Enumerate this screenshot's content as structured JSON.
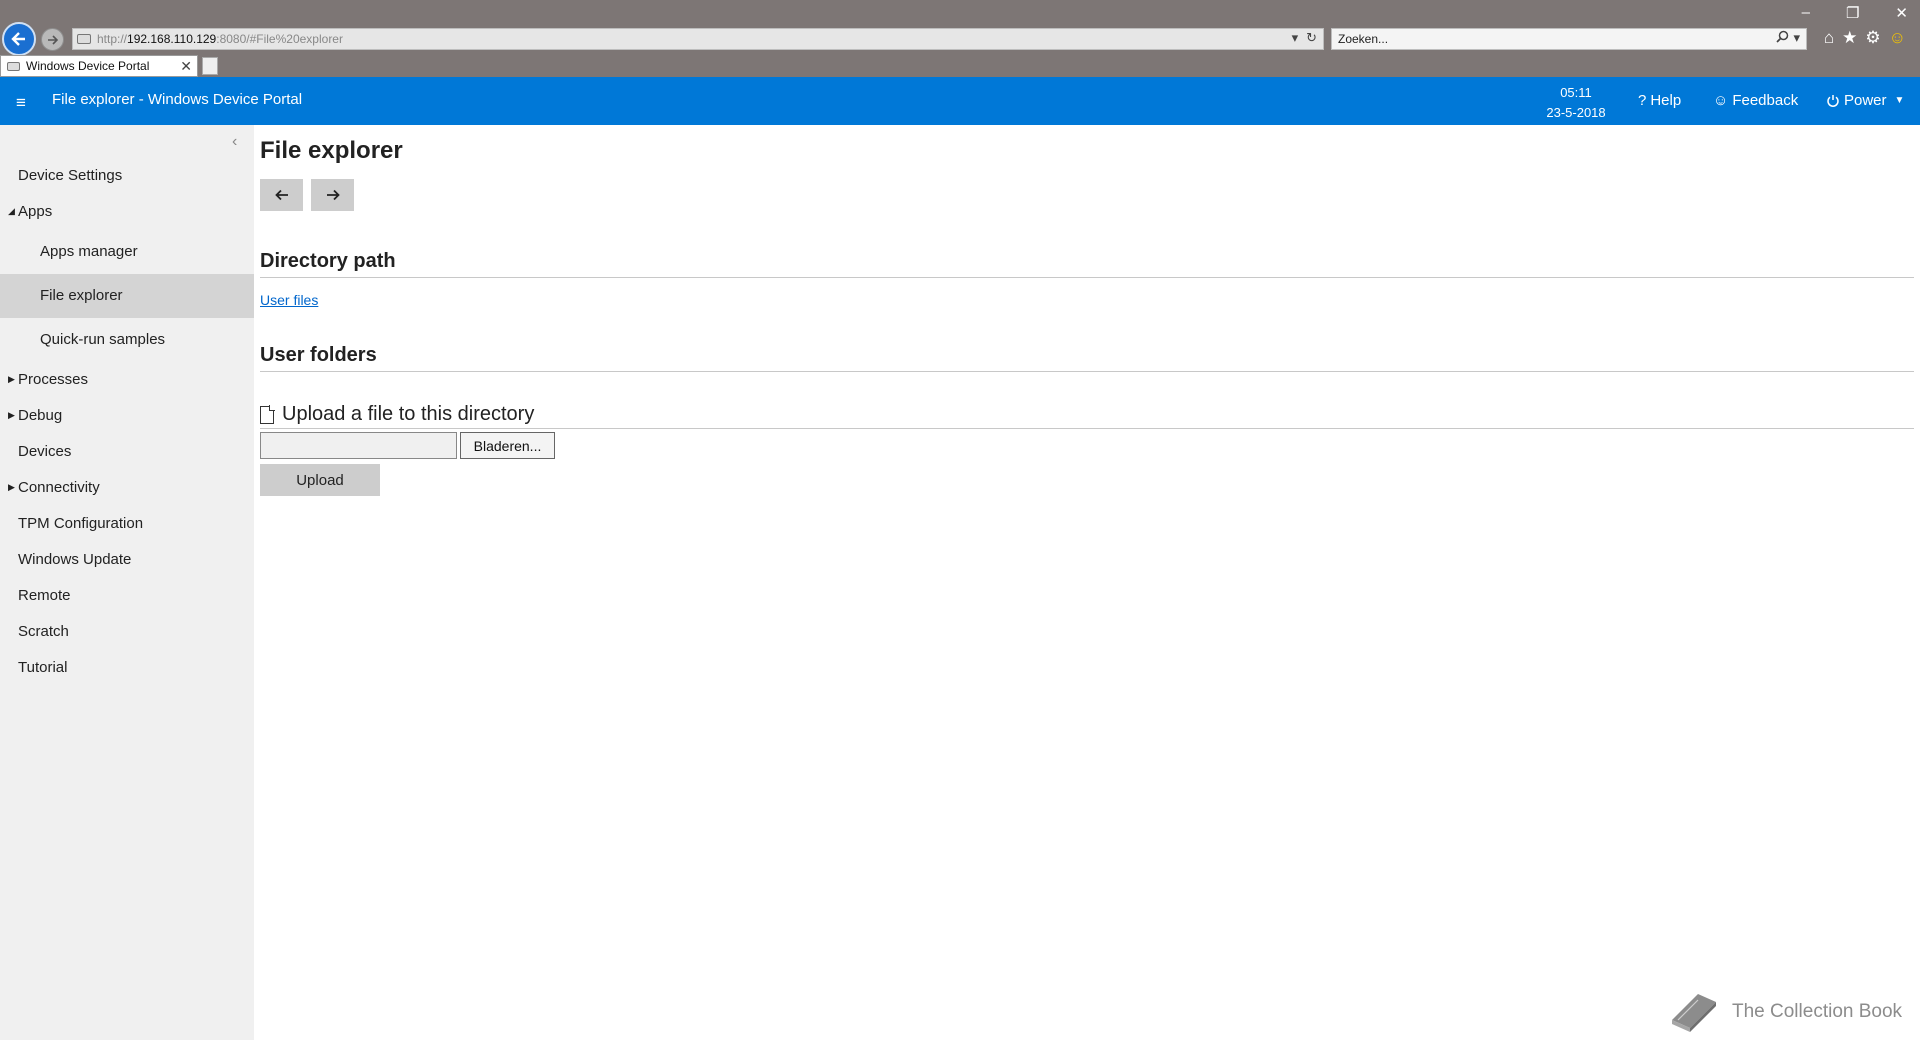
{
  "browser": {
    "url_scheme": "http://",
    "url_host": "192.168.110.129",
    "url_rest": ":8080/#File%20explorer",
    "search_placeholder": "Zoeken...",
    "tab_title": "Windows Device Portal"
  },
  "header": {
    "title": "File explorer - Windows Device Portal",
    "time": "05:11",
    "date": "23-5-2018",
    "help_label": "Help",
    "feedback_label": "Feedback",
    "power_label": "Power"
  },
  "sidebar": {
    "items": [
      {
        "label": "Device Settings"
      },
      {
        "label": "Apps"
      },
      {
        "label": "Apps manager"
      },
      {
        "label": "File explorer"
      },
      {
        "label": "Quick-run samples"
      },
      {
        "label": "Processes"
      },
      {
        "label": "Debug"
      },
      {
        "label": "Devices"
      },
      {
        "label": "Connectivity"
      },
      {
        "label": "TPM Configuration"
      },
      {
        "label": "Windows Update"
      },
      {
        "label": "Remote"
      },
      {
        "label": "Scratch"
      },
      {
        "label": "Tutorial"
      }
    ]
  },
  "main": {
    "title": "File explorer",
    "directory_path_heading": "Directory path",
    "directory_link": "User files",
    "user_folders_heading": "User folders",
    "upload_heading": "Upload a file to this directory",
    "browse_label": "Bladeren...",
    "upload_label": "Upload"
  },
  "watermark": {
    "text": "The Collection Book"
  },
  "colors": {
    "accent": "#0078d7",
    "sidebar_bg": "#f0f0f0",
    "selected_bg": "#d4d4d4",
    "link": "#0066cc"
  }
}
